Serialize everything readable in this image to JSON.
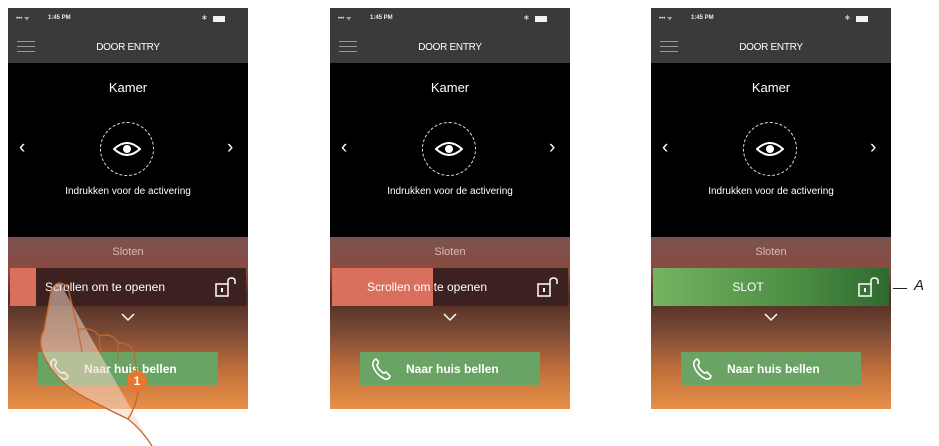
{
  "status": {
    "signal": "••• ᯤ",
    "time": "1:45 PM",
    "bluetooth": "∗"
  },
  "app": {
    "title": "DOOR ENTRY"
  },
  "camera": {
    "label": "Kamer",
    "hint": "Indrukken voor de activering",
    "prev": "‹",
    "next": "›"
  },
  "locks": {
    "section": "Sloten",
    "screen1_text": "Scrollen om te openen",
    "screen1_progress": 0.11,
    "screen2_text": "Scrollen om te openen",
    "screen2_progress": 0.43,
    "screen3_text": "SLOT"
  },
  "call": {
    "label": "Naar huis bellen"
  },
  "annotations": {
    "step": "1",
    "callout": "A"
  },
  "icons": {
    "menu": "menu-icon",
    "eye": "eye-icon",
    "lock": "unlock-icon",
    "phone": "phone-icon",
    "chevron": "chevron-down-icon"
  },
  "colors": {
    "call_button": "#6aa464",
    "slider_fill": "#d9705e",
    "lock_open": "#74b35f",
    "step_badge": "#e8762d"
  }
}
